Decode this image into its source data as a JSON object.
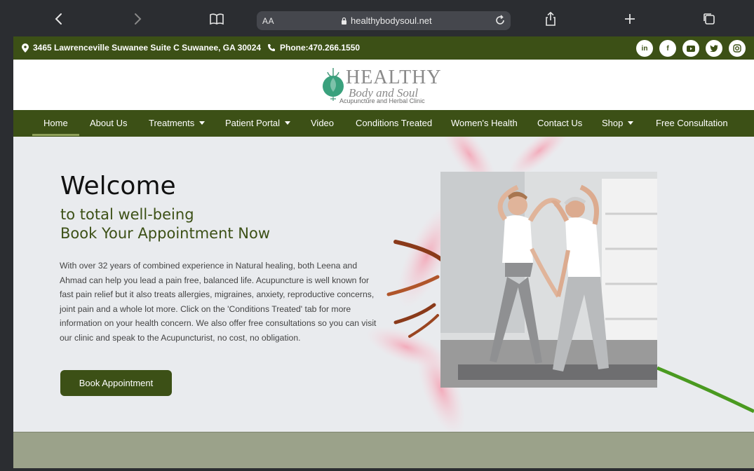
{
  "browser": {
    "text_size_label": "AA",
    "url": "healthybodysoul.net"
  },
  "topbar": {
    "address": "3465 Lawrenceville Suwanee Suite C Suwanee, GA 30024",
    "phone": "Phone:470.266.1550",
    "socials": [
      "linkedin-icon",
      "facebook-icon",
      "youtube-icon",
      "twitter-icon",
      "instagram-icon"
    ]
  },
  "logo": {
    "word": "HEALTHY",
    "sub": "Body and Soul",
    "tag": "Acupuncture and Herbal Clinic"
  },
  "nav": {
    "items": [
      {
        "label": "Home"
      },
      {
        "label": "About Us"
      },
      {
        "label": "Treatments"
      },
      {
        "label": "Patient Portal"
      },
      {
        "label": "Video"
      },
      {
        "label": "Conditions Treated"
      },
      {
        "label": "Women's Health"
      },
      {
        "label": "Contact Us"
      },
      {
        "label": "Shop"
      },
      {
        "label": "Free Consultation"
      }
    ]
  },
  "hero": {
    "title": "Welcome",
    "line1": "to total well-being",
    "line2": "Book Your Appointment Now",
    "paragraph": "With over 32 years of combined experience in Natural healing, both Leena and Ahmad can help you lead a pain free, balanced life. Acupuncture is well known for fast pain relief but it also treats allergies, migraines, anxiety, reproductive concerns, joint pain and a whole lot more. Click on the 'Conditions Treated' tab for more information on your health concern. We also offer free consultations so you can visit our clinic and speak to the Acupuncturist, no cost, no obligation.",
    "cta_label": "Book Appointment"
  },
  "colors": {
    "brand_green": "#3c5016",
    "hero_bg": "#e9ebee",
    "footer_band": "#9ba28a"
  }
}
